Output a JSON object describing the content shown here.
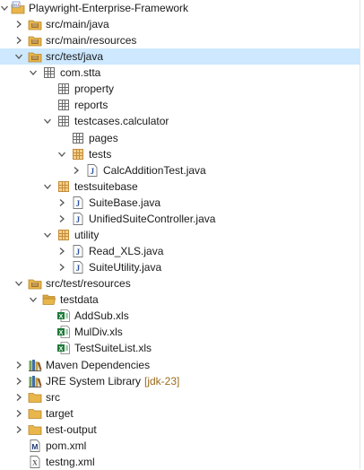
{
  "explorer": {
    "items": [
      {
        "label": "Playwright-Enterprise-Framework",
        "decoration": "",
        "icon": "project-icon",
        "depth": 0,
        "state": "expanded",
        "selected": false
      },
      {
        "label": "src/main/java",
        "decoration": "",
        "icon": "source-folder-icon",
        "depth": 1,
        "state": "collapsed",
        "selected": false
      },
      {
        "label": "src/main/resources",
        "decoration": "",
        "icon": "source-folder-icon",
        "depth": 1,
        "state": "collapsed",
        "selected": false
      },
      {
        "label": "src/test/java",
        "decoration": "",
        "icon": "source-folder-icon",
        "depth": 1,
        "state": "expanded",
        "selected": true
      },
      {
        "label": "com.stta",
        "decoration": "",
        "icon": "package-icon",
        "depth": 2,
        "state": "expanded",
        "selected": false
      },
      {
        "label": "property",
        "decoration": "",
        "icon": "package-icon",
        "depth": 3,
        "state": "none",
        "selected": false
      },
      {
        "label": "reports",
        "decoration": "",
        "icon": "package-icon",
        "depth": 3,
        "state": "none",
        "selected": false
      },
      {
        "label": "testcases.calculator",
        "decoration": "",
        "icon": "package-icon",
        "depth": 3,
        "state": "expanded",
        "selected": false
      },
      {
        "label": "pages",
        "decoration": "",
        "icon": "package-icon",
        "depth": 4,
        "state": "none",
        "selected": false
      },
      {
        "label": "tests",
        "decoration": "",
        "icon": "package-filled-icon",
        "depth": 4,
        "state": "expanded",
        "selected": false
      },
      {
        "label": "CalcAdditionTest.java",
        "decoration": "",
        "icon": "java-file-icon",
        "depth": 5,
        "state": "collapsed",
        "selected": false
      },
      {
        "label": "testsuitebase",
        "decoration": "",
        "icon": "package-filled-icon",
        "depth": 3,
        "state": "expanded",
        "selected": false
      },
      {
        "label": "SuiteBase.java",
        "decoration": "",
        "icon": "java-file-icon",
        "depth": 4,
        "state": "collapsed",
        "selected": false
      },
      {
        "label": "UnifiedSuiteController.java",
        "decoration": "",
        "icon": "java-file-icon",
        "depth": 4,
        "state": "collapsed",
        "selected": false
      },
      {
        "label": "utility",
        "decoration": "",
        "icon": "package-filled-icon",
        "depth": 3,
        "state": "expanded",
        "selected": false
      },
      {
        "label": "Read_XLS.java",
        "decoration": "",
        "icon": "java-file-icon",
        "depth": 4,
        "state": "collapsed",
        "selected": false
      },
      {
        "label": "SuiteUtility.java",
        "decoration": "",
        "icon": "java-file-icon",
        "depth": 4,
        "state": "collapsed",
        "selected": false
      },
      {
        "label": "src/test/resources",
        "decoration": "",
        "icon": "source-folder-icon",
        "depth": 1,
        "state": "expanded",
        "selected": false
      },
      {
        "label": "testdata",
        "decoration": "",
        "icon": "folder-open-icon",
        "depth": 2,
        "state": "expanded",
        "selected": false
      },
      {
        "label": "AddSub.xls",
        "decoration": "",
        "icon": "excel-file-icon",
        "depth": 3,
        "state": "none",
        "selected": false
      },
      {
        "label": "MulDiv.xls",
        "decoration": "",
        "icon": "excel-file-icon",
        "depth": 3,
        "state": "none",
        "selected": false
      },
      {
        "label": "TestSuiteList.xls",
        "decoration": "",
        "icon": "excel-file-icon",
        "depth": 3,
        "state": "none",
        "selected": false
      },
      {
        "label": "Maven Dependencies",
        "decoration": "",
        "icon": "library-icon",
        "depth": 1,
        "state": "collapsed",
        "selected": false
      },
      {
        "label": "JRE System Library",
        "decoration": "[jdk-23]",
        "icon": "library-icon",
        "depth": 1,
        "state": "collapsed",
        "selected": false
      },
      {
        "label": "src",
        "decoration": "",
        "icon": "folder-icon",
        "depth": 1,
        "state": "collapsed",
        "selected": false
      },
      {
        "label": "target",
        "decoration": "",
        "icon": "folder-icon",
        "depth": 1,
        "state": "collapsed",
        "selected": false
      },
      {
        "label": "test-output",
        "decoration": "",
        "icon": "folder-icon",
        "depth": 1,
        "state": "collapsed",
        "selected": false
      },
      {
        "label": "pom.xml",
        "decoration": "",
        "icon": "maven-pom-icon",
        "depth": 1,
        "state": "none",
        "selected": false
      },
      {
        "label": "testng.xml",
        "decoration": "",
        "icon": "xml-file-icon",
        "depth": 1,
        "state": "none",
        "selected": false
      }
    ]
  },
  "colors": {
    "selection": "#cde8ff",
    "folder": "#e8b64a",
    "package": "#6b6b6b",
    "package_filled": "#c78a3a",
    "java": "#2b4fa0",
    "excel": "#1d7a3a",
    "library": "#3f6fa8",
    "decoration": "#9a6b1a"
  }
}
